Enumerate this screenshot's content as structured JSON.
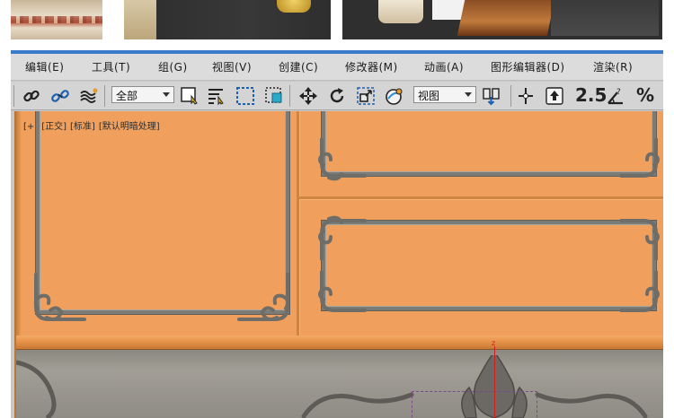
{
  "menu": {
    "items": [
      {
        "label": "编辑(E)"
      },
      {
        "label": "工具(T)"
      },
      {
        "label": "组(G)"
      },
      {
        "label": "视图(V)"
      },
      {
        "label": "创建(C)"
      },
      {
        "label": "修改器(M)"
      },
      {
        "label": "动画(A)"
      },
      {
        "label": "图形编辑器(D)"
      },
      {
        "label": "渲染(R)"
      }
    ]
  },
  "toolbar": {
    "selection_filter": "全部",
    "reference_coord": "视图",
    "snap_label": "2.5",
    "percent_label": "%"
  },
  "viewport": {
    "label_plus": "[+]",
    "label_view": "[正交]",
    "label_shading": "[标准]",
    "label_lighting": "[默认明暗处理]",
    "axis_label": "z"
  },
  "colors": {
    "viewport_bg": "#f0a05c",
    "frame": "#7d7b76",
    "axis_z": "#d21d1d",
    "titlebar_accent": "#3b79c9"
  }
}
